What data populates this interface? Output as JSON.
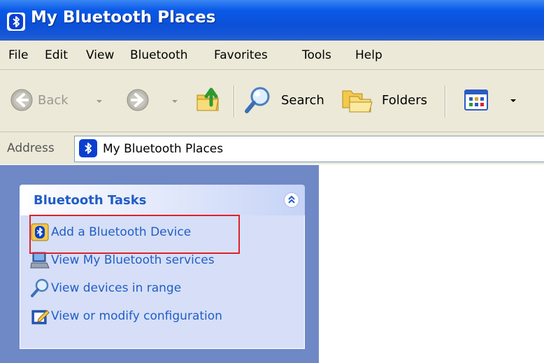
{
  "window": {
    "title": "My Bluetooth Places",
    "title_icon": "bluetooth-icon"
  },
  "menu": [
    "File",
    "Edit",
    "View",
    "Bluetooth",
    "Favorites",
    "Tools",
    "Help"
  ],
  "toolbar": {
    "back_label": "Back",
    "search_label": "Search",
    "folders_label": "Folders",
    "icons": [
      "back-arrow-icon",
      "forward-arrow-icon",
      "up-folder-icon",
      "search-icon",
      "folders-icon",
      "views-icon"
    ]
  },
  "address": {
    "label": "Address",
    "value": "My Bluetooth Places"
  },
  "tasks_panel": {
    "title": "Bluetooth Tasks",
    "items": [
      {
        "label": "Add a Bluetooth Device",
        "icon": "add-bluetooth-device-icon"
      },
      {
        "label": "View My Bluetooth services",
        "icon": "bluetooth-services-icon"
      },
      {
        "label": "View devices in range",
        "icon": "search-devices-icon"
      },
      {
        "label": "View or modify configuration",
        "icon": "configuration-icon"
      }
    ]
  },
  "colors": {
    "titlebar": "#0b50d8",
    "chrome": "#ece9d8",
    "task_pane": "#6f88c6",
    "task_link": "#215dc6",
    "highlight": "#e0202a"
  }
}
